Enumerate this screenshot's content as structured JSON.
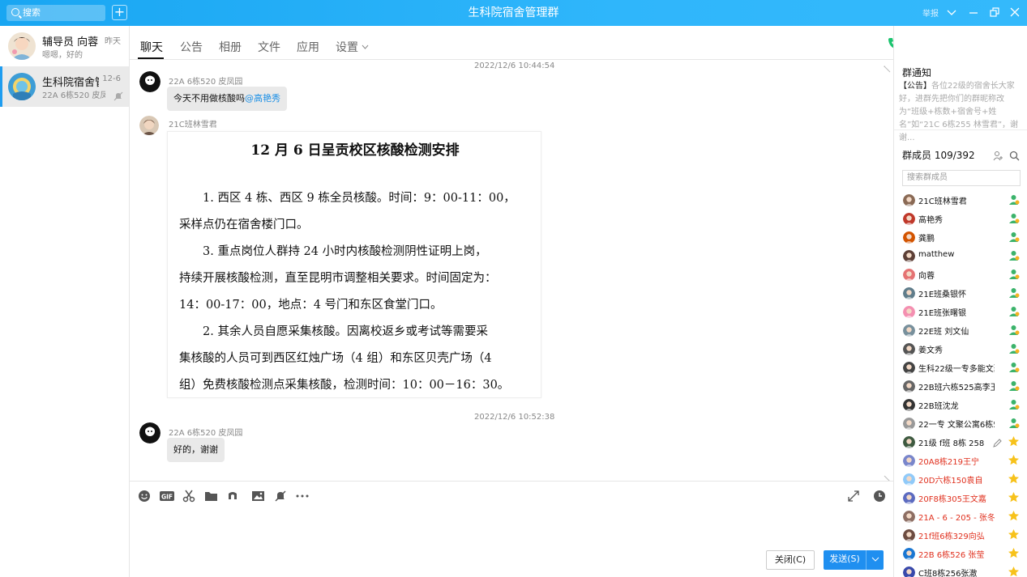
{
  "window": {
    "title": "生科院宿舍管理群",
    "search_placeholder": "搜索",
    "report_label": "举报"
  },
  "conversations": [
    {
      "name": "辅导员 向蓉",
      "time": "昨天",
      "preview": "嗯嗯，好的",
      "selected": false
    },
    {
      "name": "生科院宿舍管理群",
      "time": "12-6",
      "preview": "22A 6栋520 皮凤园",
      "selected": true
    }
  ],
  "tabs": [
    "聊天",
    "公告",
    "相册",
    "文件",
    "应用",
    "设置"
  ],
  "messages": {
    "timestamp1": "2022/12/6 10:44:54",
    "msg1_sender": "22A 6栋520 皮凤园",
    "msg1_text": "今天不用做核酸吗",
    "msg1_mention": "@高艳秀",
    "msg2_sender": "21C班林雪君",
    "timestamp2": "2022/12/6 10:52:38",
    "msg3_sender": "22A 6栋520 皮凤园",
    "msg3_text": "好的，谢谢"
  },
  "document_image": {
    "title": "12 月 6 日呈贡校区核酸检测安排",
    "lines": [
      "　　1. 西区 4 栋、西区 9 栋全员核酸。时间：9：00-11：00，",
      "采样点仍在宿舍楼门口。",
      "　　3. 重点岗位人群持 24 小时内核酸检测阴性证明上岗，",
      "持续开展核酸检测，直至昆明市调整相关要求。时间固定为：",
      "14：00-17：00，地点：4 号门和东区食堂门口。",
      "　　2. 其余人员自愿采集核酸。因离校返乡或考试等需要采",
      "集核酸的人员可到西区红烛广场（4 组）和东区贝壳广场（4",
      "组）免费核酸检测点采集核酸，检测时间：10：00－16：30。"
    ]
  },
  "composer": {
    "close_label": "关闭(C)",
    "send_label": "发送(S)"
  },
  "notice": {
    "title": "群通知",
    "tag": "【公告】",
    "text": "各位22级的宿舍长大家好，进群先把你们的群昵称改为“班级+栋数+宿舍号+姓名”如“21C 6栋255 林雪君”，谢谢..."
  },
  "members": {
    "title": "群成员 109/392",
    "search_placeholder": "搜索群成员",
    "list": [
      {
        "name": "21C班林雪君",
        "role": "admin",
        "red": false
      },
      {
        "name": "高艳秀",
        "role": "admin",
        "red": false
      },
      {
        "name": "龚鹏",
        "role": "admin",
        "red": false
      },
      {
        "name": "matthew",
        "role": "admin",
        "red": false
      },
      {
        "name": "向蓉",
        "role": "admin",
        "red": false
      },
      {
        "name": "21E班桑银怀",
        "role": "admin",
        "red": false
      },
      {
        "name": "21E班张曙银",
        "role": "admin",
        "red": false
      },
      {
        "name": "22E班 刘文仙",
        "role": "admin",
        "red": false
      },
      {
        "name": "姜文秀",
        "role": "admin",
        "red": false
      },
      {
        "name": "生科22级一专多能文聚公",
        "role": "admin",
        "red": false
      },
      {
        "name": "22B班六栋525高李玉",
        "role": "admin",
        "red": false
      },
      {
        "name": "22B班沈龙",
        "role": "admin",
        "red": false
      },
      {
        "name": "22一专 文聚公寓6栋519",
        "role": "admin",
        "red": false
      },
      {
        "name": "21级 f班 8栋 258",
        "role": "star",
        "red": false
      },
      {
        "name": "20A8栋219王宁",
        "role": "star",
        "red": true
      },
      {
        "name": "20D六栋150袁自",
        "role": "star",
        "red": true
      },
      {
        "name": "20F8栋305王文嘉",
        "role": "star",
        "red": true
      },
      {
        "name": "21A - 6 - 205 - 张冬",
        "role": "star",
        "red": true
      },
      {
        "name": "21f班6栋329向弘",
        "role": "star",
        "red": true
      },
      {
        "name": "22B  6栋526 张莹",
        "role": "star",
        "red": true
      },
      {
        "name": "C班8栋256张澈",
        "role": "star",
        "red": false
      }
    ]
  },
  "colors": {
    "titlebar": "#1da8f5",
    "accent": "#1f8ff0",
    "member_red": "#e0301e"
  }
}
